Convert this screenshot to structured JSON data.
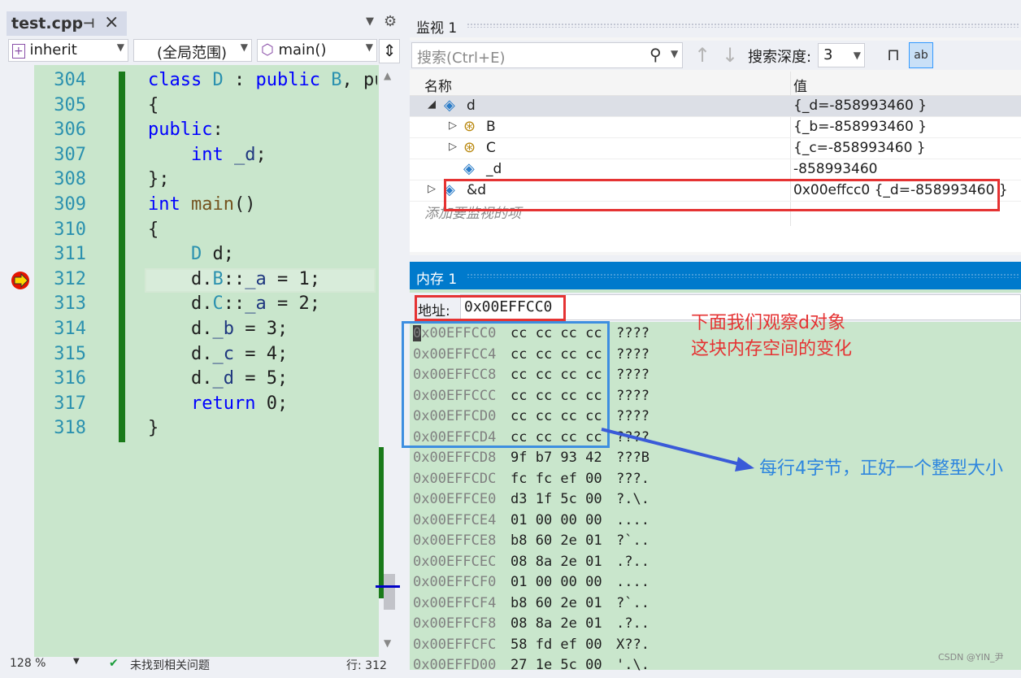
{
  "editor": {
    "tab_label": "test.cpp",
    "pin_icon": "pin-icon",
    "close_icon": "close-icon",
    "class_combo": "inherit",
    "scope_combo": "(全局范围)",
    "func_combo": "main()",
    "lines": [
      {
        "num": "304",
        "text": "class D : public B, pub"
      },
      {
        "num": "305",
        "text": "{"
      },
      {
        "num": "306",
        "text": "public:"
      },
      {
        "num": "307",
        "text": "    int _d;"
      },
      {
        "num": "308",
        "text": "};"
      },
      {
        "num": "309",
        "text": "int main()"
      },
      {
        "num": "310",
        "text": "{"
      },
      {
        "num": "311",
        "text": "    D d;"
      },
      {
        "num": "312",
        "text": "    d.B::_a = 1;"
      },
      {
        "num": "313",
        "text": "    d.C::_a = 2;"
      },
      {
        "num": "314",
        "text": "    d._b = 3;"
      },
      {
        "num": "315",
        "text": "    d._c = 4;"
      },
      {
        "num": "316",
        "text": "    d._d = 5;"
      },
      {
        "num": "317",
        "text": "    return 0;"
      },
      {
        "num": "318",
        "text": "}"
      }
    ],
    "zoom": "128 %",
    "status_text": "未找到相关问题",
    "line_status": "行: 312"
  },
  "watch": {
    "title": "监视 1",
    "search_placeholder": "搜索(Ctrl+E)",
    "depth_label": "搜索深度:",
    "depth_value": "3",
    "col_name": "名称",
    "col_value": "值",
    "rows": [
      {
        "name": "d",
        "value": "{_d=-858993460 }"
      },
      {
        "name": "B",
        "value": "{_b=-858993460 }"
      },
      {
        "name": "C",
        "value": "{_c=-858993460 }"
      },
      {
        "name": "_d",
        "value": "-858993460"
      },
      {
        "name": "&d",
        "value": "0x00effcc0 {_d=-858993460 }"
      }
    ],
    "add_item": "添加要监视的项"
  },
  "memory": {
    "title": "内存 1",
    "address_label": "地址:",
    "address_value": "0x00EFFCC0",
    "rows": [
      {
        "addr": "0x00EFFCC0",
        "hex": "cc cc cc cc",
        "ascii": "????"
      },
      {
        "addr": "0x00EFFCC4",
        "hex": "cc cc cc cc",
        "ascii": "????"
      },
      {
        "addr": "0x00EFFCC8",
        "hex": "cc cc cc cc",
        "ascii": "????"
      },
      {
        "addr": "0x00EFFCCC",
        "hex": "cc cc cc cc",
        "ascii": "????"
      },
      {
        "addr": "0x00EFFCD0",
        "hex": "cc cc cc cc",
        "ascii": "????"
      },
      {
        "addr": "0x00EFFCD4",
        "hex": "cc cc cc cc",
        "ascii": "????"
      },
      {
        "addr": "0x00EFFCD8",
        "hex": "9f b7 93 42",
        "ascii": "???B"
      },
      {
        "addr": "0x00EFFCDC",
        "hex": "fc fc ef 00",
        "ascii": "???."
      },
      {
        "addr": "0x00EFFCE0",
        "hex": "d3 1f 5c 00",
        "ascii": "?.\\."
      },
      {
        "addr": "0x00EFFCE4",
        "hex": "01 00 00 00",
        "ascii": "...."
      },
      {
        "addr": "0x00EFFCE8",
        "hex": "b8 60 2e 01",
        "ascii": "?`.."
      },
      {
        "addr": "0x00EFFCEC",
        "hex": "08 8a 2e 01",
        "ascii": ".?.."
      },
      {
        "addr": "0x00EFFCF0",
        "hex": "01 00 00 00",
        "ascii": "...."
      },
      {
        "addr": "0x00EFFCF4",
        "hex": "b8 60 2e 01",
        "ascii": "?`.."
      },
      {
        "addr": "0x00EFFCF8",
        "hex": "08 8a 2e 01",
        "ascii": ".?.."
      },
      {
        "addr": "0x00EFFCFC",
        "hex": "58 fd ef 00",
        "ascii": "X??."
      },
      {
        "addr": "0x00EFFD00",
        "hex": "27 1e 5c 00",
        "ascii": "'.\\."
      }
    ]
  },
  "annotations": {
    "note_red": "下面我们观察d对象\n这块内存空间的变化",
    "note_blue": "每行4字节，正好一个整型大小",
    "red_color": "#e53333",
    "blue_color": "#2e86de"
  },
  "watermark": "CSDN @YIN_尹"
}
